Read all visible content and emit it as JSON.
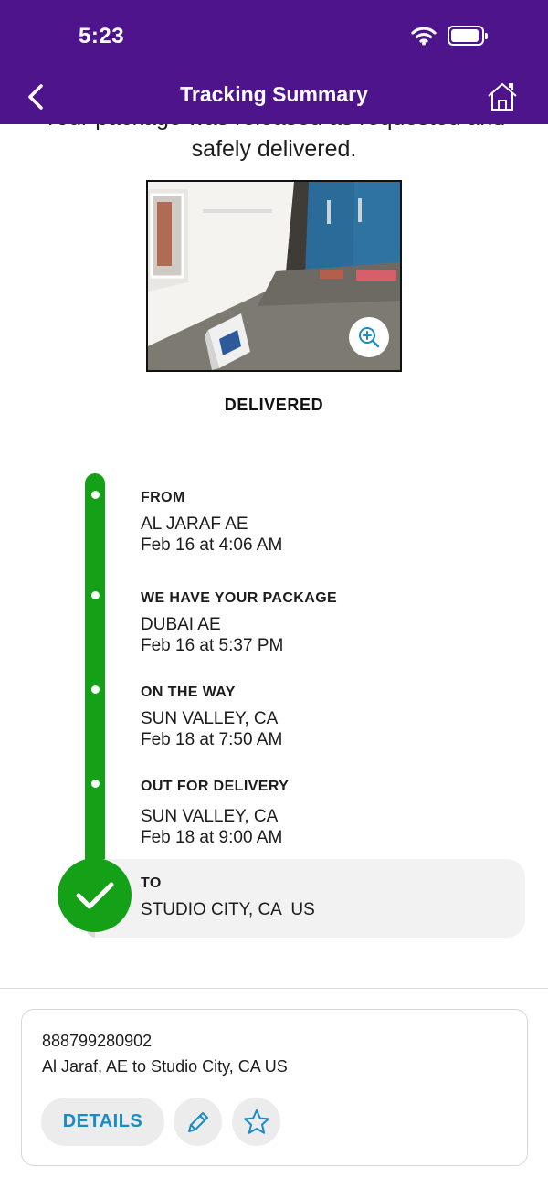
{
  "status_bar": {
    "time": "5:23"
  },
  "header": {
    "title": "Tracking Summary",
    "back_icon": "chevron-left-icon",
    "home_icon": "home-icon"
  },
  "delivery": {
    "message": "Your package was released as requested and safely delivered.",
    "status": "DELIVERED"
  },
  "timeline": {
    "events": [
      {
        "title": "FROM",
        "location": "AL JARAF AE",
        "datetime": "Feb 16 at 4:06 AM"
      },
      {
        "title": "WE HAVE YOUR PACKAGE",
        "location": "DUBAI AE",
        "datetime": "Feb 16 at 5:37 PM"
      },
      {
        "title": "ON THE WAY",
        "location": "SUN VALLEY, CA",
        "datetime": "Feb 18 at 7:50 AM"
      },
      {
        "title": "OUT FOR DELIVERY",
        "location": "SUN VALLEY, CA",
        "datetime": "Feb 18 at 9:00 AM"
      },
      {
        "title": "TO",
        "location": "STUDIO CITY, CA  US"
      }
    ]
  },
  "shipment": {
    "tracking_number": "888799280902",
    "route": "Al Jaraf, AE to Studio City, CA US",
    "details_label": "DETAILS"
  },
  "colors": {
    "header": "#4d148c",
    "progress": "#14a118",
    "link": "#1a8bc4"
  }
}
